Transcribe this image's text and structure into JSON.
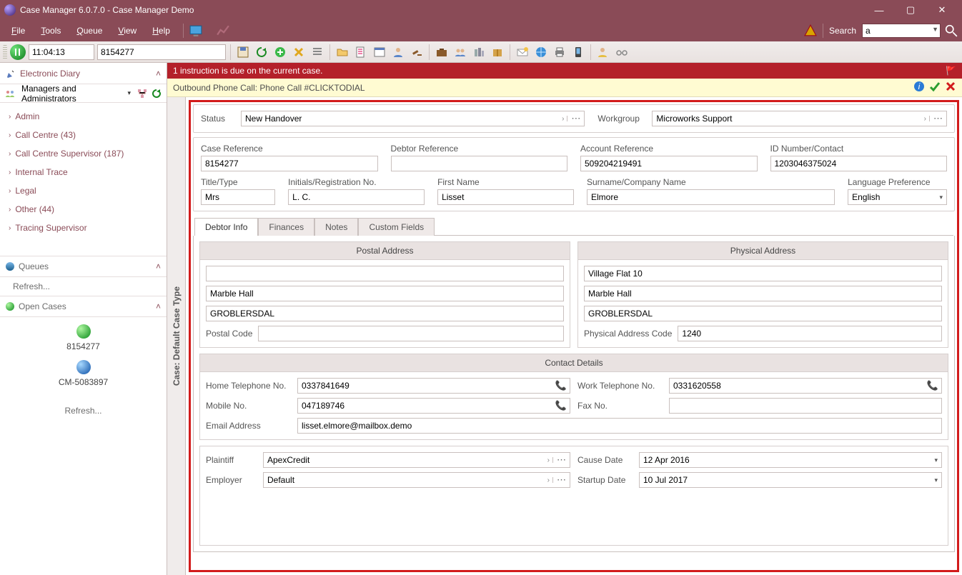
{
  "window": {
    "title": "Case Manager 6.0.7.0 - Case Manager Demo"
  },
  "menu": {
    "file": "File",
    "tools": "Tools",
    "queue": "Queue",
    "view": "View",
    "help": "Help",
    "search_label": "Search",
    "search_value": "a"
  },
  "toolbar": {
    "time": "11:04:13",
    "case_id": "8154277"
  },
  "sidebar": {
    "diary_title": "Electronic Diary",
    "group_label": "Managers and Administrators",
    "nodes": [
      "Admin",
      "Call Centre (43)",
      "Call Centre Supervisor (187)",
      "Internal Trace",
      "Legal",
      "Other (44)",
      "Tracing Supervisor"
    ],
    "queues_title": "Queues",
    "refresh": "Refresh...",
    "open_cases_title": "Open Cases",
    "open_cases": [
      "8154277",
      "CM-5083897"
    ]
  },
  "notices": {
    "red": "1 instruction is due on the current case.",
    "yellow": "Outbound Phone Call: Phone Call #CLICKTODIAL"
  },
  "vtab": "Case: Default Case Type",
  "form": {
    "status_label": "Status",
    "status_value": "New Handover",
    "workgroup_label": "Workgroup",
    "workgroup_value": "Microworks Support",
    "case_ref_label": "Case Reference",
    "case_ref": "8154277",
    "debtor_ref_label": "Debtor Reference",
    "debtor_ref": "",
    "acct_ref_label": "Account Reference",
    "acct_ref": "509204219491",
    "idnum_label": "ID Number/Contact",
    "idnum": "1203046375024",
    "title_label": "Title/Type",
    "title_value": "Mrs",
    "initials_label": "Initials/Registration No.",
    "initials": "L. C.",
    "first_label": "First Name",
    "first": "Lisset",
    "surname_label": "Surname/Company Name",
    "surname": "Elmore",
    "lang_label": "Language Preference",
    "lang": "English",
    "tabs": [
      "Debtor Info",
      "Finances",
      "Notes",
      "Custom Fields"
    ],
    "postal_hdr": "Postal Address",
    "physical_hdr": "Physical Address",
    "postal_line1": "",
    "postal_line2": "Marble Hall",
    "postal_line3": "GROBLERSDAL",
    "postal_code_label": "Postal Code",
    "postal_code": "",
    "phys_line1": "Village Flat 10",
    "phys_line2": "Marble Hall",
    "phys_line3": "GROBLERSDAL",
    "phys_code_label": "Physical Address Code",
    "phys_code": "1240",
    "contact_hdr": "Contact Details",
    "home_label": "Home Telephone No.",
    "home": "0337841649",
    "work_label": "Work Telephone No.",
    "work": "0331620558",
    "mobile_label": "Mobile No.",
    "mobile": "047189746",
    "fax_label": "Fax No.",
    "fax": "",
    "email_label": "Email Address",
    "email": "lisset.elmore@mailbox.demo",
    "plaintiff_label": "Plaintiff",
    "plaintiff": "ApexCredit",
    "cause_label": "Cause Date",
    "cause": "12 Apr 2016",
    "employer_label": "Employer",
    "employer": "Default",
    "startup_label": "Startup Date",
    "startup": "10 Jul 2017"
  }
}
